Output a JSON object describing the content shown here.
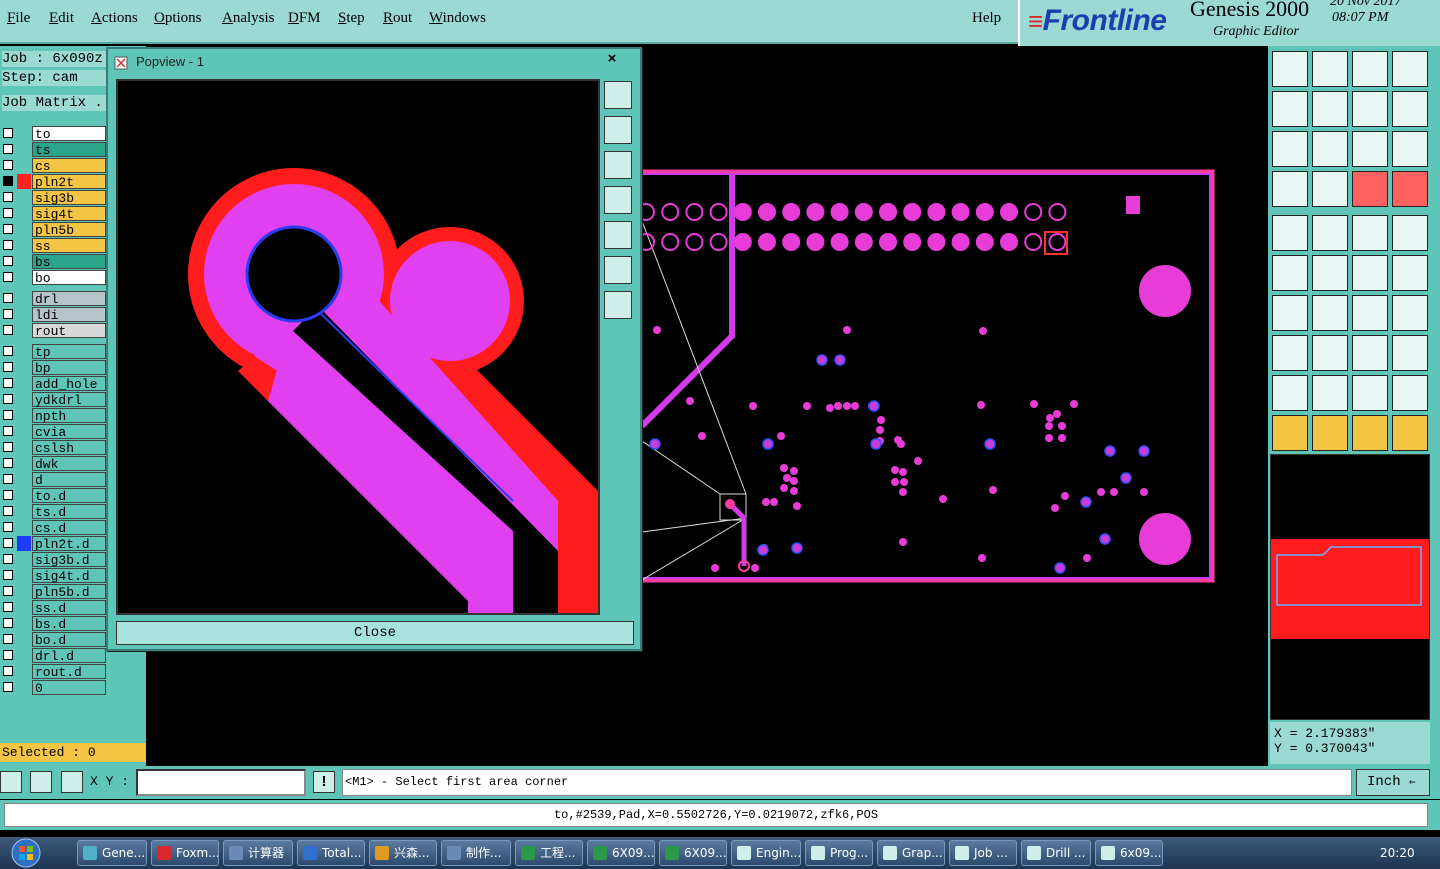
{
  "menu": [
    "File",
    "Edit",
    "Actions",
    "Options",
    "Analysis",
    "DFM",
    "Step",
    "Rout",
    "Windows"
  ],
  "help": "Help",
  "logo": {
    "brand": "Frontline",
    "title": "Genesis 2000",
    "subtitle": "Graphic Editor",
    "date": "20 Nov 2017",
    "time": "08:07 PM"
  },
  "left": {
    "job": "Job : 6x090z",
    "step": "Step: cam",
    "matrix": "Job Matrix .",
    "selected": "Selected : 0",
    "layers": [
      {
        "name": "to",
        "color": "#ffffff",
        "flag": ""
      },
      {
        "name": "ts",
        "color": "#2aa58a",
        "flag": ""
      },
      {
        "name": "cs",
        "color": "#f4c542",
        "flag": ""
      },
      {
        "name": "pln2t",
        "color": "#f4c542",
        "flag": "#ff2020",
        "active": true
      },
      {
        "name": "sig3b",
        "color": "#f4c542",
        "flag": ""
      },
      {
        "name": "sig4t",
        "color": "#f4c542",
        "flag": ""
      },
      {
        "name": "pln5b",
        "color": "#f4c542",
        "flag": ""
      },
      {
        "name": "ss",
        "color": "#f4c542",
        "flag": ""
      },
      {
        "name": "bs",
        "color": "#2aa58a",
        "flag": ""
      },
      {
        "name": "bo",
        "color": "#ffffff",
        "flag": ""
      },
      {
        "name": "drl",
        "color": "#b4c4c8",
        "flag": "",
        "gap": true
      },
      {
        "name": "ldi",
        "color": "#b4c4c8",
        "flag": ""
      },
      {
        "name": "rout",
        "color": "#d8d8d8",
        "flag": ""
      },
      {
        "name": "tp",
        "color": "#5fc5b8",
        "flag": "",
        "gap": true
      },
      {
        "name": "bp",
        "color": "#5fc5b8",
        "flag": ""
      },
      {
        "name": "add_hole",
        "color": "#5fc5b8",
        "flag": ""
      },
      {
        "name": "ydkdrl",
        "color": "#5fc5b8",
        "flag": ""
      },
      {
        "name": "npth",
        "color": "#5fc5b8",
        "flag": ""
      },
      {
        "name": "cvia",
        "color": "#5fc5b8",
        "flag": ""
      },
      {
        "name": "cslsh",
        "color": "#5fc5b8",
        "flag": ""
      },
      {
        "name": "dwk",
        "color": "#5fc5b8",
        "flag": ""
      },
      {
        "name": "d",
        "color": "#5fc5b8",
        "flag": ""
      },
      {
        "name": "to.d",
        "color": "#5fc5b8",
        "flag": ""
      },
      {
        "name": "ts.d",
        "color": "#5fc5b8",
        "flag": ""
      },
      {
        "name": "cs.d",
        "color": "#5fc5b8",
        "flag": ""
      },
      {
        "name": "pln2t.d",
        "color": "#5fc5b8",
        "flag": "#1e3cff"
      },
      {
        "name": "sig3b.d",
        "color": "#5fc5b8",
        "flag": ""
      },
      {
        "name": "sig4t.d",
        "color": "#5fc5b8",
        "flag": ""
      },
      {
        "name": "pln5b.d",
        "color": "#5fc5b8",
        "flag": ""
      },
      {
        "name": "ss.d",
        "color": "#5fc5b8",
        "flag": ""
      },
      {
        "name": "bs.d",
        "color": "#5fc5b8",
        "flag": ""
      },
      {
        "name": "bo.d",
        "color": "#5fc5b8",
        "flag": ""
      },
      {
        "name": "drl.d",
        "color": "#5fc5b8",
        "flag": ""
      },
      {
        "name": "rout.d",
        "color": "#5fc5b8",
        "flag": ""
      },
      {
        "name": "0",
        "color": "#5fc5b8",
        "flag": ""
      }
    ]
  },
  "popview": {
    "title": "Popview - 1",
    "close_x": "×",
    "close_button": "Close"
  },
  "coords": {
    "x": "X = 2.179383\"",
    "y": "Y = 0.370043\""
  },
  "command": {
    "xy_label": "X Y :",
    "input_value": "",
    "excl": "!",
    "prompt": "<M1> - Select first area corner",
    "unit": "Inch"
  },
  "status": "to,#2539,Pad,X=0.5502726,Y=0.0219072,zfk6,POS",
  "taskbar": {
    "tasks": [
      {
        "label": "Gene...",
        "color": "#4fb0c6"
      },
      {
        "label": "Foxm...",
        "color": "#d8282a"
      },
      {
        "label": "计算器",
        "color": "#6a8bb5"
      },
      {
        "label": "Total...",
        "color": "#2e6fd0"
      },
      {
        "label": "兴森...",
        "color": "#e09a20"
      },
      {
        "label": "制作...",
        "color": "#6a8bb5"
      },
      {
        "label": "工程...",
        "color": "#2a9a4a"
      },
      {
        "label": "6X09...",
        "color": "#2a9a4a"
      },
      {
        "label": "6X09...",
        "color": "#2a9a4a"
      },
      {
        "label": "Engin...",
        "color": "#cfeeea"
      },
      {
        "label": "Prog...",
        "color": "#cfeeea"
      },
      {
        "label": "Grap...",
        "color": "#cfeeea"
      },
      {
        "label": "Job ...",
        "color": "#cfeeea"
      },
      {
        "label": "Drill ...",
        "color": "#cfeeea"
      },
      {
        "label": "6x09...",
        "color": "#cfeeea"
      }
    ],
    "clock": "20:20"
  }
}
